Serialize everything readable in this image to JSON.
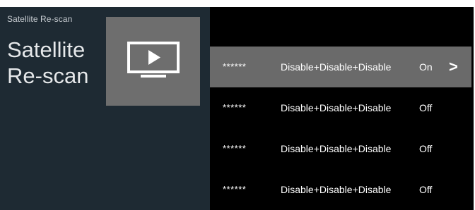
{
  "header": {
    "breadcrumb": "Satellite Re-scan",
    "title_line1": "Satellite",
    "title_line2": "Re-scan"
  },
  "tile": {
    "icon": "tv-play-icon"
  },
  "list": {
    "rows": [
      {
        "name": "******",
        "description": "Disable+Disable+Disable",
        "state": "On",
        "chevron": ">"
      },
      {
        "name": "******",
        "description": "Disable+Disable+Disable",
        "state": "Off"
      },
      {
        "name": "******",
        "description": "Disable+Disable+Disable",
        "state": "Off"
      },
      {
        "name": "******",
        "description": "Disable+Disable+Disable",
        "state": "Off"
      }
    ]
  },
  "colors": {
    "left_panel_bg": "#1e2a33",
    "right_panel_bg": "#000000",
    "tile_bg": "#6e6e6e",
    "selected_row_bg": "#6a6a6a",
    "text": "#ffffff"
  }
}
